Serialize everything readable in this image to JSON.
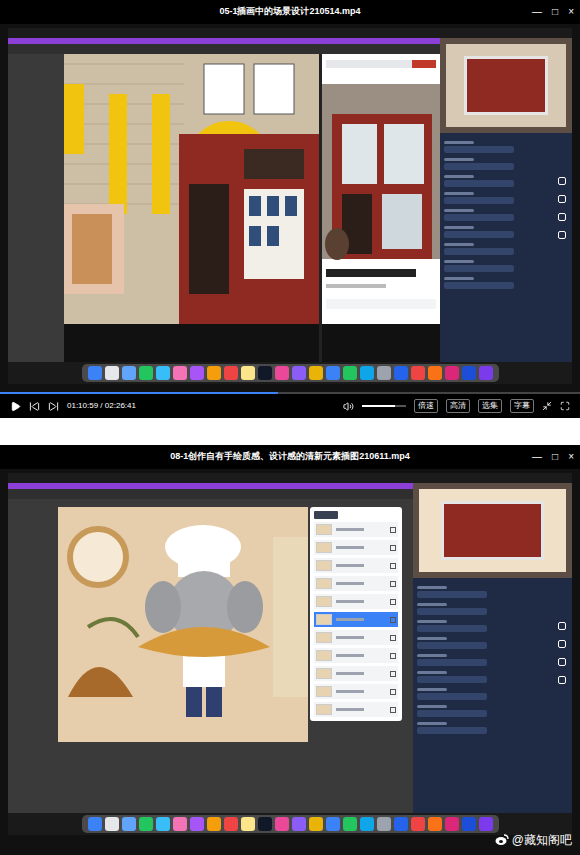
{
  "players": [
    {
      "title": "05-1插画中的场景设计210514.mp4",
      "window_controls": [
        "—",
        "□",
        "×"
      ],
      "progress": {
        "level": 0.48
      },
      "controls": {
        "time": "01:10:59 / 02:26:41",
        "volume": {
          "level": 0.75
        },
        "buttons": [
          "倍速",
          "高清",
          "选集",
          "字幕"
        ]
      }
    },
    {
      "title": "08-1创作自有手绘质感、设计感的清新元素插图210611.mp4",
      "window_controls": [
        "—",
        "□",
        "×"
      ]
    }
  ],
  "watermark": "@藏知阁吧"
}
